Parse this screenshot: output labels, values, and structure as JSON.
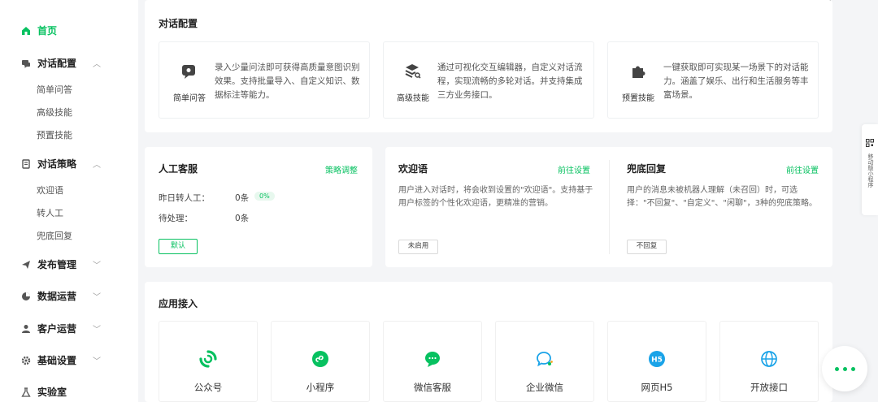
{
  "sidebar": {
    "home": "首页",
    "dialog_config": {
      "label": "对话配置",
      "items": [
        "简单问答",
        "高级技能",
        "预置技能"
      ]
    },
    "dialog_strategy": {
      "label": "对话策略",
      "items": [
        "欢迎语",
        "转人工",
        "兜底回复"
      ]
    },
    "publish": "发布管理",
    "data_ops": "数据运营",
    "customer_ops": "客户运营",
    "basic_settings": "基础设置",
    "lab": "实验室"
  },
  "dialog_config_card": {
    "title": "对话配置",
    "features": [
      {
        "label": "简单问答",
        "desc": "录入少量问法即可获得高质量意图识别效果。支持批量导入、自定义知识、数据标注等能力。",
        "icon": "chat-bubble-icon"
      },
      {
        "label": "高级技能",
        "desc": "通过可视化交互编辑器，自定义对话流程，实现流畅的多轮对话。并支持集成三方业务接口。",
        "icon": "layers-search-icon"
      },
      {
        "label": "预置技能",
        "desc": "一键获取即可实现某一场景下的对话能力。涵盖了娱乐、出行和生活服务等丰富场景。",
        "icon": "puzzle-icon"
      }
    ]
  },
  "human_service": {
    "title": "人工客服",
    "link": "策略调整",
    "yesterday_label": "昨日转人工：",
    "yesterday_value": "0条",
    "yesterday_pct": "0%",
    "pending_label": "待处理：",
    "pending_value": "0条",
    "button": "默认"
  },
  "welcome": {
    "title": "欢迎语",
    "link": "前往设置",
    "desc": "用户进入对话时，将会收到设置的\"欢迎语\"。支持基于用户标签的个性化欢迎语，更精准的营销。",
    "status": "未启用"
  },
  "fallback": {
    "title": "兜底回复",
    "link": "前往设置",
    "desc": "用户的消息未被机器人理解（未召回）时，可选择：\"不回复\"、\"自定义\"、\"闲聊\"，3种的兜底策略。",
    "status": "不回复"
  },
  "apps": {
    "title": "应用接入",
    "items": [
      {
        "label": "公众号",
        "icon": "official-account-icon"
      },
      {
        "label": "小程序",
        "icon": "mini-program-icon"
      },
      {
        "label": "微信客服",
        "icon": "wechat-service-icon"
      },
      {
        "label": "企业微信",
        "icon": "work-wechat-icon"
      },
      {
        "label": "网页H5",
        "icon": "h5-icon",
        "badge": "H5"
      },
      {
        "label": "开放接口",
        "icon": "globe-icon"
      }
    ]
  },
  "float": {
    "title": "移动版小程序"
  },
  "colors": {
    "accent": "#07c160",
    "blue": "#1aa3e8",
    "background": "#f4f5f7"
  }
}
